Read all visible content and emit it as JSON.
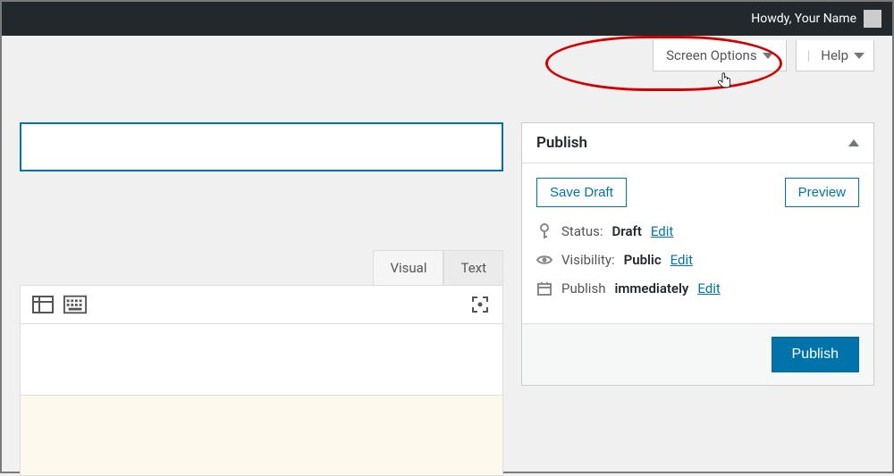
{
  "adminbar": {
    "greeting": "Howdy, Your Name"
  },
  "screenMeta": {
    "screenOptions": "Screen Options",
    "help": "Help"
  },
  "title": {
    "value": ""
  },
  "editor": {
    "tabs": {
      "visual": "Visual",
      "text": "Text"
    }
  },
  "publish": {
    "title": "Publish",
    "saveDraft": "Save Draft",
    "preview": "Preview",
    "statusLabel": "Status:",
    "statusValue": "Draft",
    "statusEdit": "Edit",
    "visLabel": "Visibility:",
    "visValue": "Public",
    "visEdit": "Edit",
    "schedLabel": "Publish",
    "schedValue": "immediately",
    "schedEdit": "Edit",
    "publishBtn": "Publish"
  }
}
